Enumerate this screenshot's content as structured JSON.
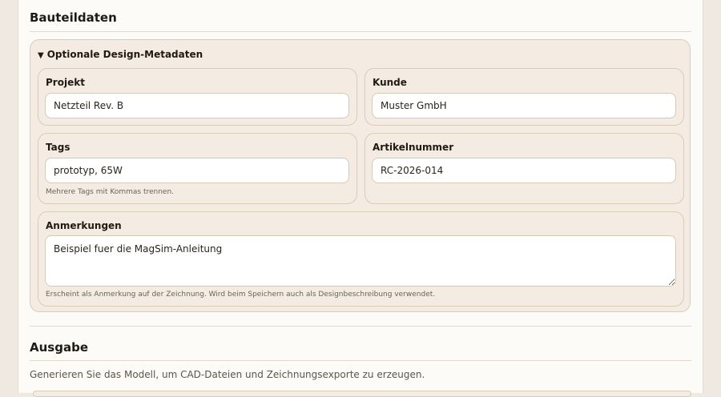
{
  "bauteildaten": {
    "title": "Bauteildaten",
    "details_summary": "Optionale Design-Metadaten",
    "fields": {
      "projekt": {
        "label": "Projekt",
        "value": "Netzteil Rev. B"
      },
      "kunde": {
        "label": "Kunde",
        "value": "Muster GmbH"
      },
      "tags": {
        "label": "Tags",
        "value": "prototyp, 65W",
        "hint": "Mehrere Tags mit Kommas trennen."
      },
      "artikelnummer": {
        "label": "Artikelnummer",
        "value": "RC-2026-014"
      },
      "anmerkungen": {
        "label": "Anmerkungen",
        "value": "Beispiel fuer die MagSim-Anleitung",
        "hint": "Erscheint als Anmerkung auf der Zeichnung. Wird beim Speichern auch als Designbeschreibung verwendet."
      }
    }
  },
  "ausgabe": {
    "title": "Ausgabe",
    "description": "Generieren Sie das Modell, um CAD-Dateien und Zeichnungsexporte zu erzeugen."
  }
}
